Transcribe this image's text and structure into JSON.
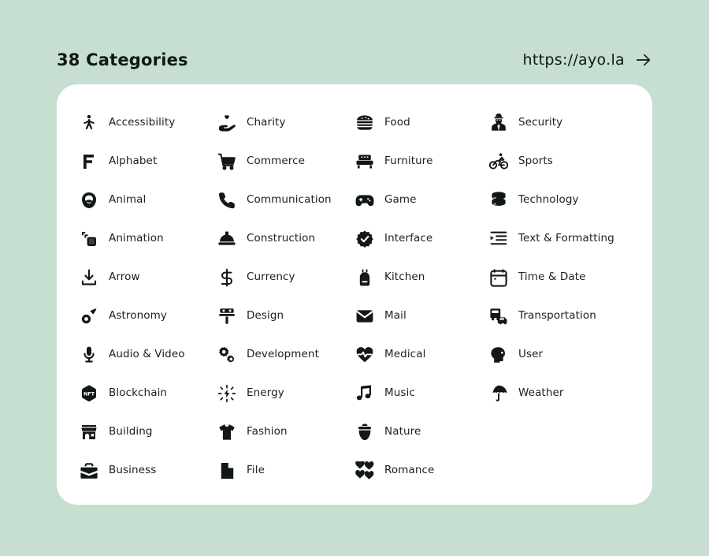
{
  "header": {
    "title": "38 Categories",
    "link_text": "https://ayo.la",
    "link_arrow_icon": "arrow-right-icon"
  },
  "theme": {
    "background": "#c6dfd0",
    "card_background": "#ffffff",
    "text": "#17211d",
    "icon": "#111816"
  },
  "columns": [
    {
      "items": [
        {
          "label": "Accessibility",
          "icon": "accessibility-person-icon"
        },
        {
          "label": "Alphabet",
          "icon": "letter-f-icon"
        },
        {
          "label": "Animal",
          "icon": "monkey-face-icon"
        },
        {
          "label": "Animation",
          "icon": "stacked-frames-icon"
        },
        {
          "label": "Arrow",
          "icon": "download-arrow-icon"
        },
        {
          "label": "Astronomy",
          "icon": "comet-icon"
        },
        {
          "label": "Audio & Video",
          "icon": "microphone-icon"
        },
        {
          "label": "Blockchain",
          "icon": "nft-hexagon-icon"
        },
        {
          "label": "Building",
          "icon": "storefront-icon"
        },
        {
          "label": "Business",
          "icon": "briefcase-icon"
        }
      ]
    },
    {
      "items": [
        {
          "label": "Charity",
          "icon": "hand-heart-icon"
        },
        {
          "label": "Commerce",
          "icon": "shopping-cart-icon"
        },
        {
          "label": "Communication",
          "icon": "phone-icon"
        },
        {
          "label": "Construction",
          "icon": "hard-hat-icon"
        },
        {
          "label": "Currency",
          "icon": "dollar-sign-icon"
        },
        {
          "label": "Design",
          "icon": "paint-roller-icon"
        },
        {
          "label": "Development",
          "icon": "gears-icon"
        },
        {
          "label": "Energy",
          "icon": "spark-burst-icon"
        },
        {
          "label": "Fashion",
          "icon": "tshirt-icon"
        },
        {
          "label": "File",
          "icon": "document-icon"
        }
      ]
    },
    {
      "items": [
        {
          "label": "Food",
          "icon": "burger-icon"
        },
        {
          "label": "Furniture",
          "icon": "sofa-icon"
        },
        {
          "label": "Game",
          "icon": "gamepad-icon"
        },
        {
          "label": "Interface",
          "icon": "verified-badge-icon"
        },
        {
          "label": "Kitchen",
          "icon": "apron-icon"
        },
        {
          "label": "Mail",
          "icon": "envelope-icon"
        },
        {
          "label": "Medical",
          "icon": "heart-pulse-icon"
        },
        {
          "label": "Music",
          "icon": "music-note-icon"
        },
        {
          "label": "Nature",
          "icon": "acorn-icon"
        },
        {
          "label": "Romance",
          "icon": "hearts-icon"
        }
      ]
    },
    {
      "items": [
        {
          "label": "Security",
          "icon": "security-guard-icon"
        },
        {
          "label": "Sports",
          "icon": "bicycle-icon"
        },
        {
          "label": "Technology",
          "icon": "database-icon"
        },
        {
          "label": "Text & Formatting",
          "icon": "text-indent-icon"
        },
        {
          "label": "Time & Date",
          "icon": "calendar-icon"
        },
        {
          "label": "Transportation",
          "icon": "bus-car-icon"
        },
        {
          "label": "User",
          "icon": "head-profile-icon"
        },
        {
          "label": "Weather",
          "icon": "umbrella-icon"
        }
      ]
    }
  ]
}
